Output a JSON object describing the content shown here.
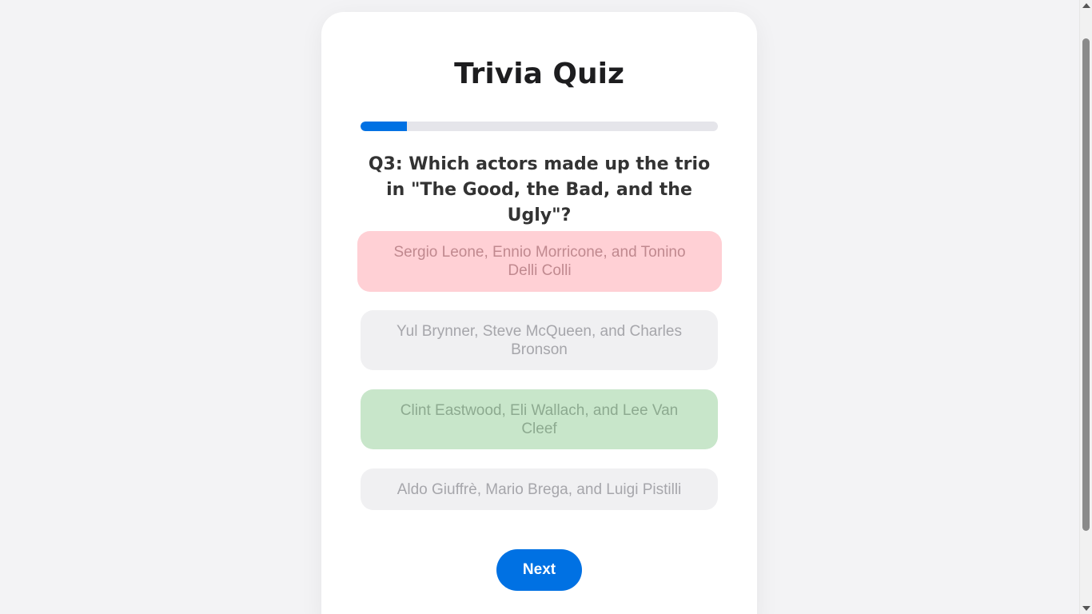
{
  "quiz": {
    "title": "Trivia Quiz",
    "progress_fraction": 0.13,
    "question": "Q3: Which actors made up the trio in \"The Good, the Bad, and the Ugly\"?",
    "options": [
      {
        "label": "Sergio Leone, Ennio Morricone, and Tonino Delli Colli",
        "state": "incorrect-selected"
      },
      {
        "label": "Yul Brynner, Steve McQueen, and Charles Bronson",
        "state": "neutral"
      },
      {
        "label": "Clint Eastwood, Eli Wallach, and Lee Van Cleef",
        "state": "correct"
      },
      {
        "label": "Aldo Giuffrè, Mario Brega, and Luigi Pistilli",
        "state": "neutral"
      }
    ],
    "next_label": "Next"
  },
  "colors": {
    "accent": "#0071e3",
    "incorrect": "#ffd0d5",
    "correct": "#c8e6ca",
    "neutral": "#f0f0f2",
    "background": "#f3f3f5"
  }
}
